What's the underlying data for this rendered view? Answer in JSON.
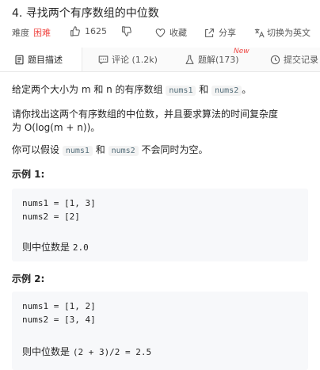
{
  "problem": {
    "title": "4. 寻找两个有序数组的中位数",
    "difficulty_label": "难度",
    "difficulty": "困难",
    "likes": "1625",
    "favorite": "收藏",
    "share": "分享",
    "switch_lang": "切换为英文"
  },
  "tabs": [
    {
      "label": "题目描述"
    },
    {
      "label": "评论 (1.2k)"
    },
    {
      "label": "题解(173)"
    },
    {
      "label": "提交记录"
    }
  ],
  "new_badge": "New",
  "description": {
    "p1_a": "给定两个大小为 m 和 n 的有序数组 ",
    "p1_code1": "nums1",
    "p1_b": " 和 ",
    "p1_code2": "nums2",
    "p1_c": "。",
    "p2_line1": "请你找出这两个有序数组的中位数，并且要求算法的时间复杂度",
    "p2_line2": "为 O(log(m + n))。",
    "p3_a": "你可以假设 ",
    "p3_code1": "nums1",
    "p3_b": " 和 ",
    "p3_code2": "nums2",
    "p3_c": " 不会同时为空。"
  },
  "examples": [
    {
      "heading": "示例 1:",
      "line1": "nums1 = [1, 3]",
      "line2": "nums2 = [2]",
      "result_label": "则中位数是 ",
      "result_value": "2.0"
    },
    {
      "heading": "示例 2:",
      "line1": "nums1 = [1, 2]",
      "line2": "nums2 = [3, 4]",
      "result_label": "则中位数是 ",
      "result_value": "(2 + 3)/2 = 2.5"
    }
  ],
  "colors": {
    "hard": "#ef4743",
    "text": "#262626",
    "muted": "#595959",
    "code_bg": "#f7f8fa"
  }
}
